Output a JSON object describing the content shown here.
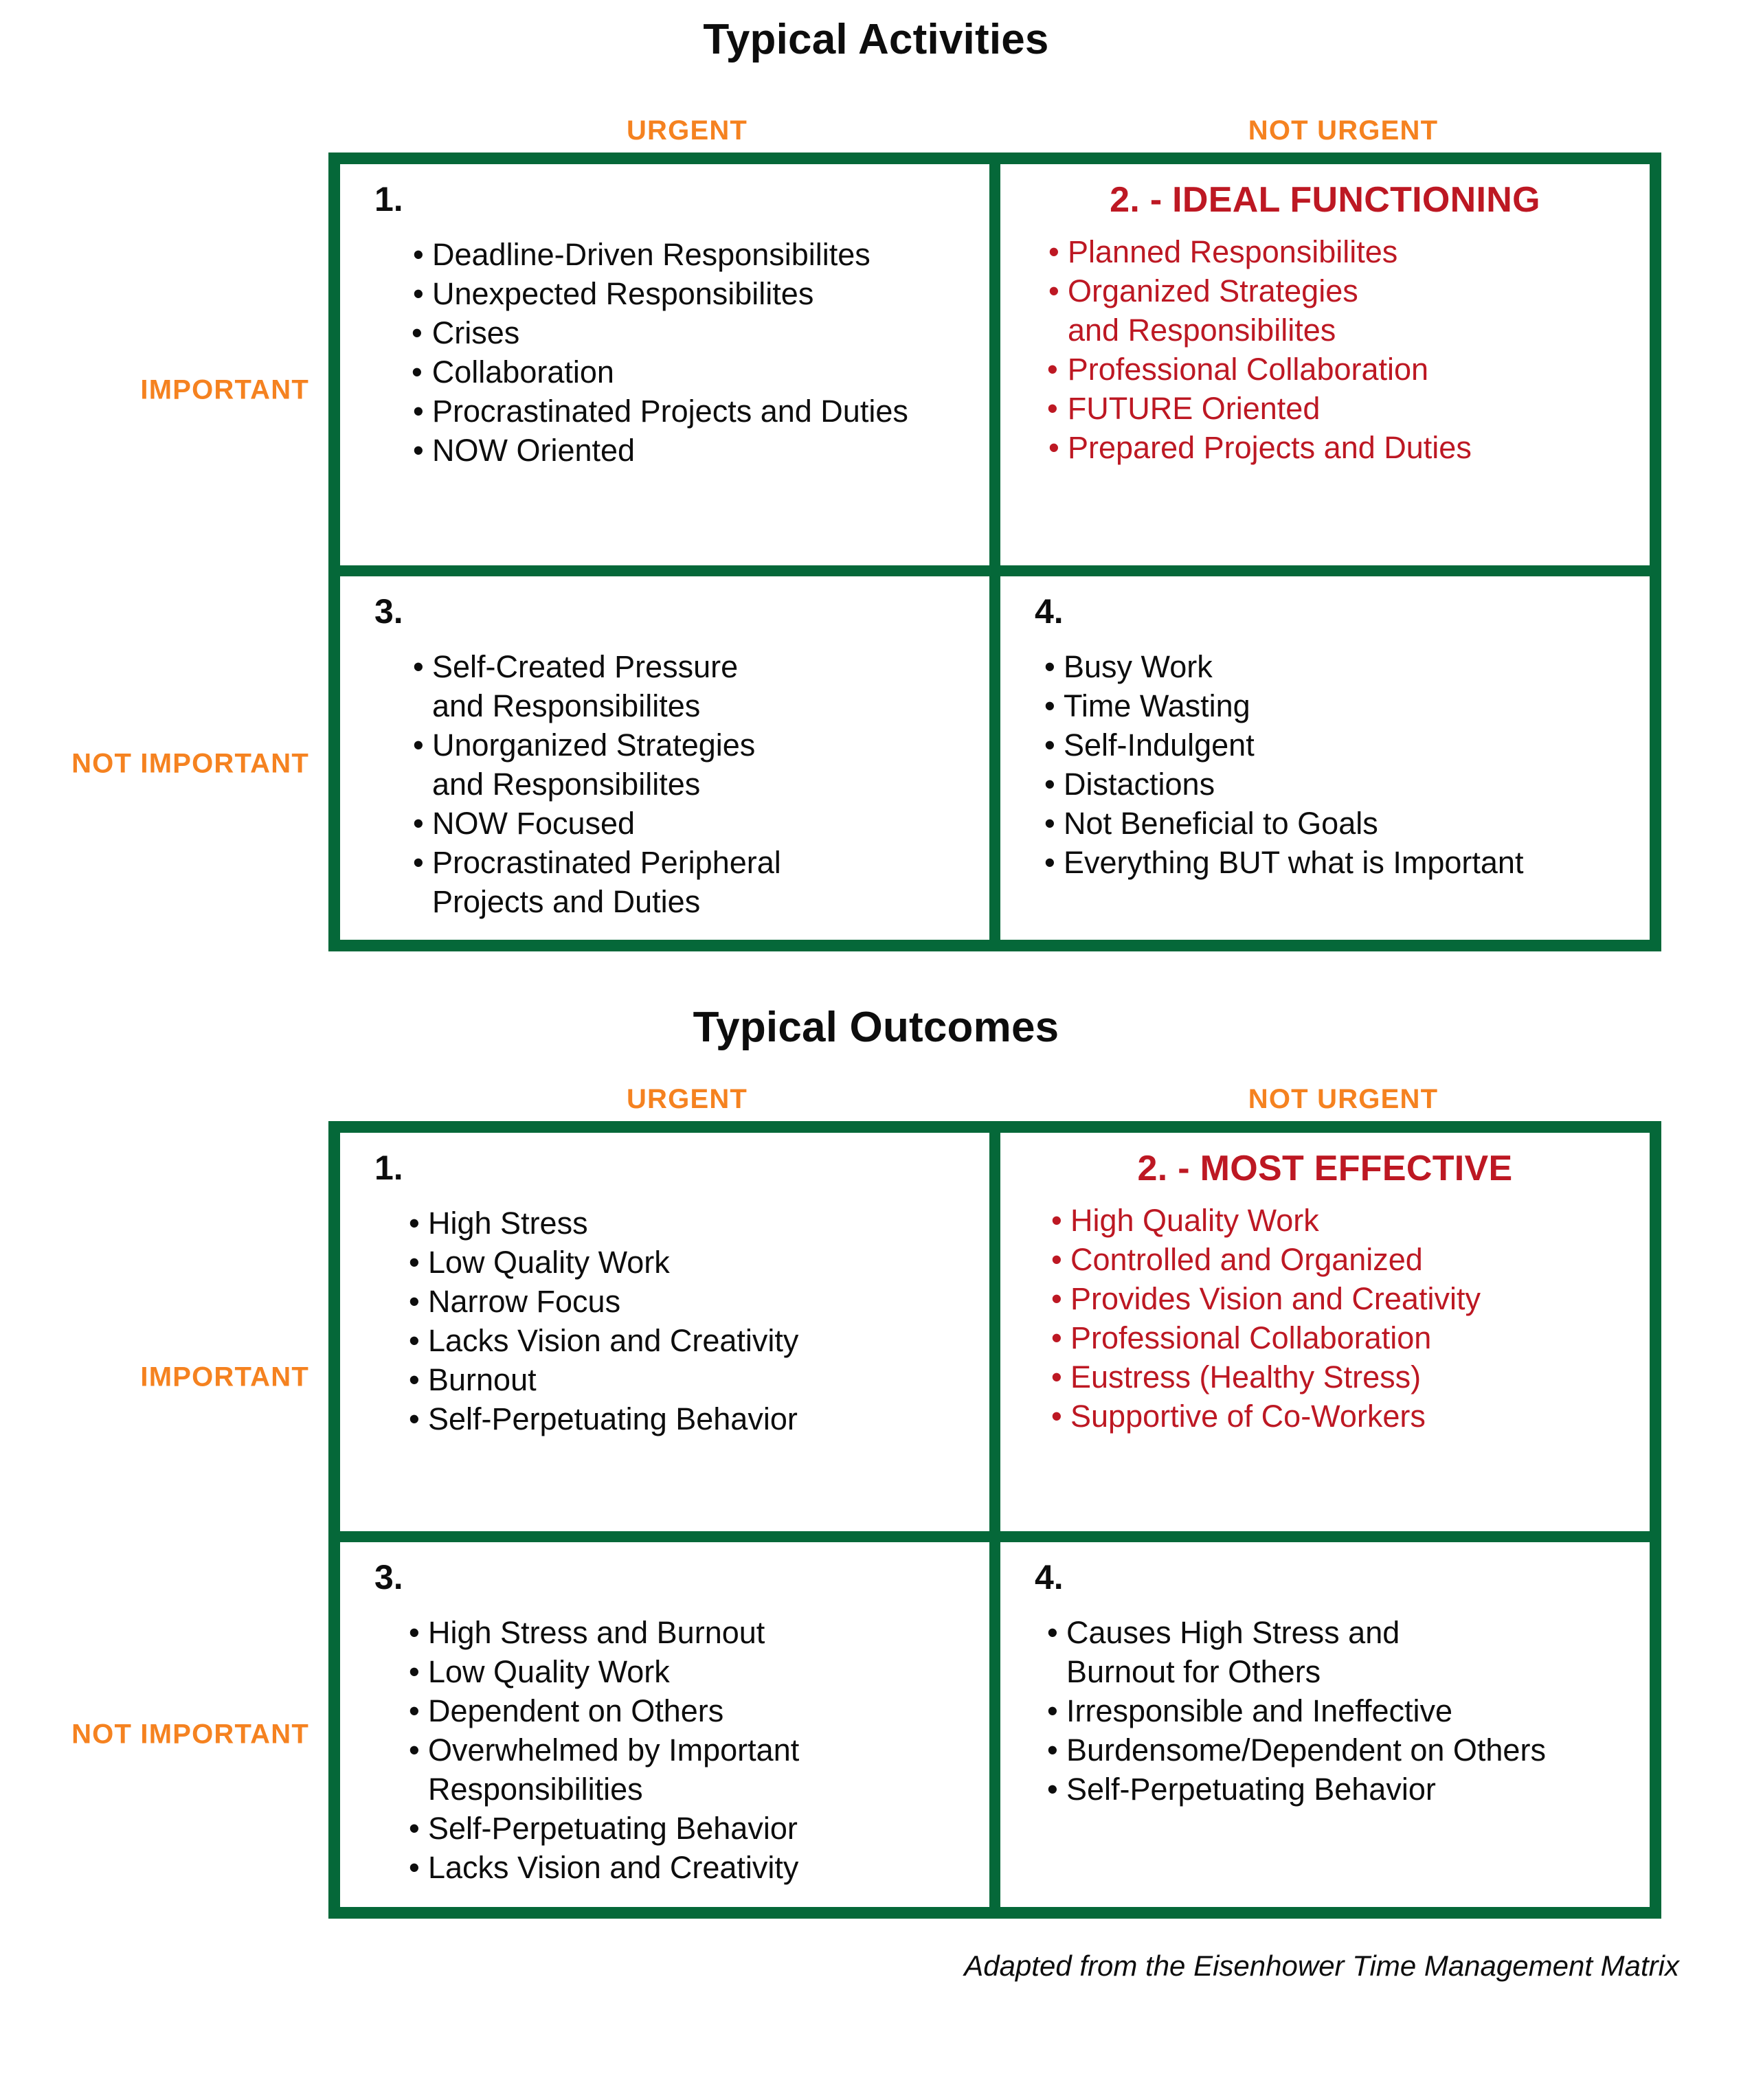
{
  "colors": {
    "border_green": "#056839",
    "accent_orange": "#f58220",
    "highlight_red": "#bd1823",
    "text_black": "#0d0d0d"
  },
  "sections": [
    {
      "id": "activities",
      "title": "Typical Activities",
      "column_headers": {
        "urgent": "URGENT",
        "not_urgent": "NOT URGENT"
      },
      "row_headers": {
        "important": "IMPORTANT",
        "not_important": "NOT IMPORTANT"
      },
      "quadrants": {
        "q1": {
          "number": "1.",
          "title": "",
          "items": [
            "Deadline-Driven Responsibilites",
            "Unexpected Responsibilites",
            "Crises",
            "Collaboration",
            "Procrastinated Projects and Duties",
            "NOW Oriented"
          ]
        },
        "q2": {
          "number": "",
          "title": "2. - IDEAL FUNCTIONING",
          "items": [
            "Planned Responsibilites",
            "Organized Strategies\nand Responsibilites",
            "Professional Collaboration",
            "FUTURE Oriented",
            "Prepared Projects and Duties"
          ]
        },
        "q3": {
          "number": "3.",
          "title": "",
          "items": [
            "Self-Created Pressure\nand Responsibilites",
            "Unorganized Strategies\nand Responsibilites",
            "NOW Focused",
            "Procrastinated Peripheral\nProjects and Duties"
          ]
        },
        "q4": {
          "number": "4.",
          "title": "",
          "items": [
            "Busy Work",
            "Time Wasting",
            "Self-Indulgent",
            "Distactions",
            "Not Beneficial to Goals",
            "Everything BUT what is Important"
          ]
        }
      }
    },
    {
      "id": "outcomes",
      "title": "Typical Outcomes",
      "column_headers": {
        "urgent": "URGENT",
        "not_urgent": "NOT URGENT"
      },
      "row_headers": {
        "important": "IMPORTANT",
        "not_important": "NOT IMPORTANT"
      },
      "quadrants": {
        "q1": {
          "number": "1.",
          "title": "",
          "items": [
            "High Stress",
            "Low Quality Work",
            "Narrow Focus",
            "Lacks Vision and Creativity",
            "Burnout",
            "Self-Perpetuating Behavior"
          ]
        },
        "q2": {
          "number": "",
          "title": "2. - MOST EFFECTIVE",
          "items": [
            "High Quality Work",
            "Controlled and Organized",
            "Provides Vision and Creativity",
            "Professional Collaboration",
            "Eustress (Healthy Stress)",
            "Supportive of Co-Workers"
          ]
        },
        "q3": {
          "number": "3.",
          "title": "",
          "items": [
            "High Stress and Burnout",
            "Low Quality Work",
            "Dependent on Others",
            "Overwhelmed by Important\nResponsibilities",
            "Self-Perpetuating Behavior",
            "Lacks Vision and Creativity"
          ]
        },
        "q4": {
          "number": "4.",
          "title": "",
          "items": [
            "Causes High Stress and\nBurnout for Others",
            "Irresponsible and Ineffective",
            "Burdensome/Dependent on Others",
            "Self-Perpetuating Behavior"
          ]
        }
      }
    }
  ],
  "footer": {
    "attribution": "Adapted from the Eisenhower Time Management Matrix"
  }
}
